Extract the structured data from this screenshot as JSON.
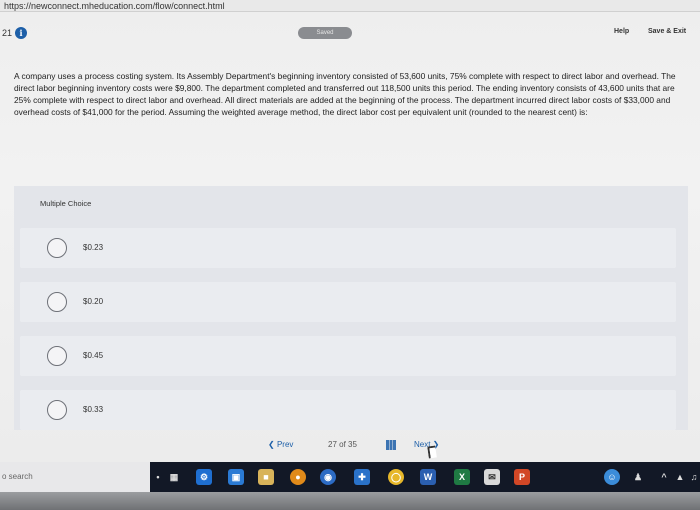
{
  "browser": {
    "url": "https://newconnect.mheducation.com/flow/connect.html"
  },
  "header": {
    "question_number": "21",
    "saved_label": "Saved",
    "help_label": "Help",
    "save_exit_label": "Save & Exit"
  },
  "question": {
    "text": "A company uses a process costing system. Its Assembly Department's beginning inventory consisted of 53,600 units, 75% complete with respect to direct labor and overhead. The direct labor beginning inventory costs were $9,800. The department completed and transferred out 118,500 units this period. The ending inventory consists of 43,600 units that are 25% complete with respect to direct labor and overhead. All direct materials are added at the beginning of the process. The department incurred direct labor costs of $33,000 and overhead costs of $41,000 for the period. Assuming the weighted average method, the direct labor cost per equivalent unit (rounded to the nearest cent) is:"
  },
  "choices": {
    "label": "Multiple Choice",
    "options": [
      "$0.23",
      "$0.20",
      "$0.45",
      "$0.33"
    ]
  },
  "pager": {
    "prev_label": "Prev",
    "page_text": "27 of 35",
    "next_label": "Next"
  },
  "taskbar": {
    "search_placeholder": "o search"
  }
}
